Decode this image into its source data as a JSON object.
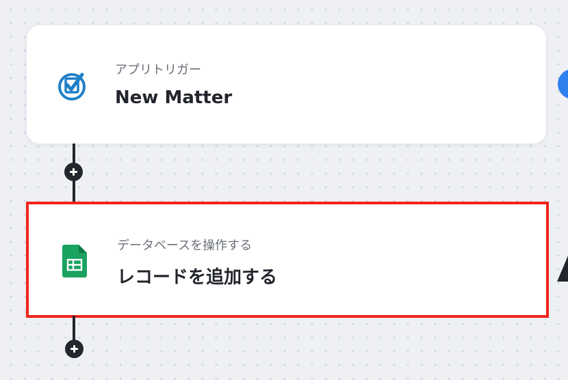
{
  "flow": {
    "trigger_step": {
      "label": "アプリトリガー",
      "title": "New Matter",
      "icon": "checkbox-logo-icon"
    },
    "action_step": {
      "label": "データベースを操作する",
      "title": "レコードを追加する",
      "icon": "google-sheets-icon",
      "selected": true
    },
    "add_step_buttons": [
      "plus-icon",
      "plus-icon"
    ]
  },
  "colors": {
    "background": "#eef0f4",
    "selected_outline": "#f0231b",
    "connector": "#23262d",
    "trigger_icon": "#1e7fc7",
    "sheets_icon": "#1aa260",
    "side_badge": "#2f80ed"
  }
}
